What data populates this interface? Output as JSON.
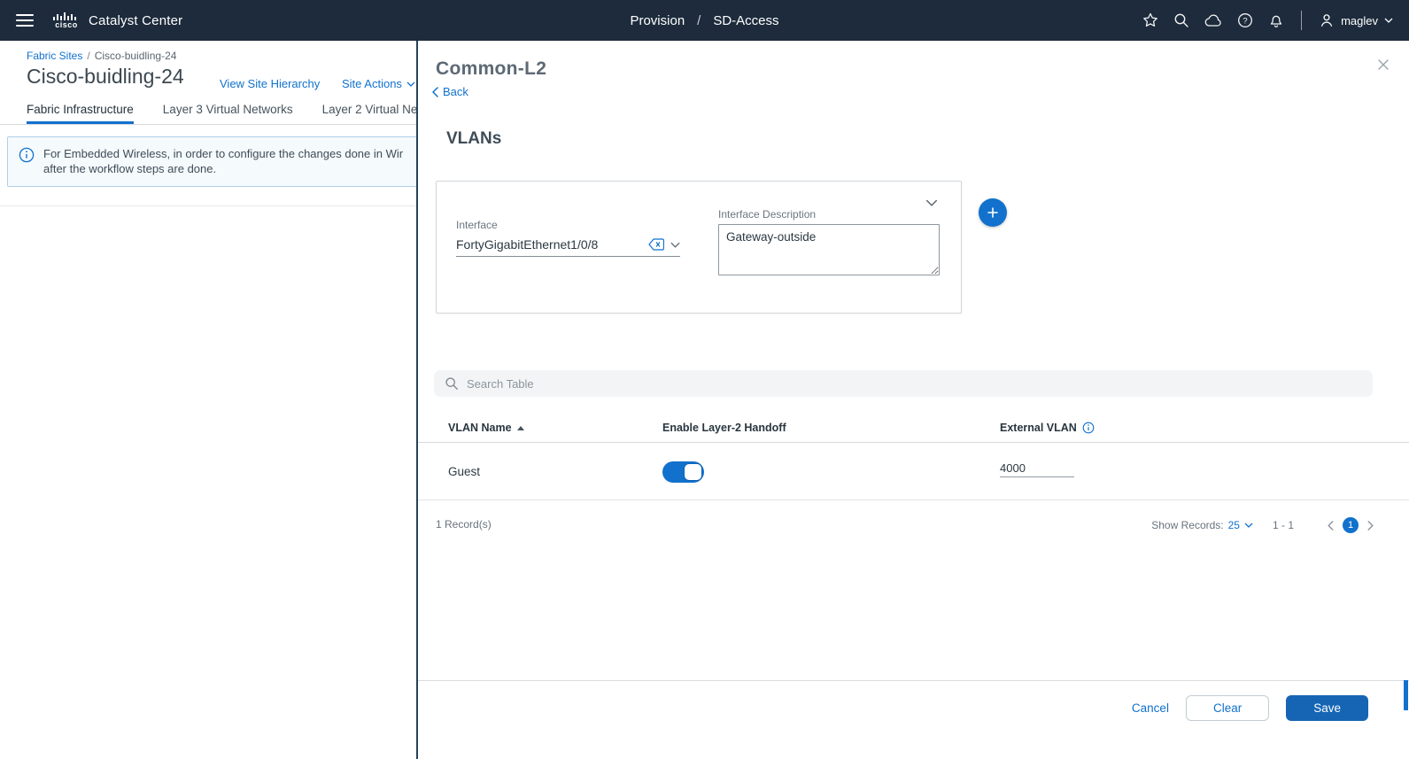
{
  "colors": {
    "topbar_bg": "#1d2b3c",
    "accent": "#1171cd",
    "save_blue": "#1565b4"
  },
  "topbar": {
    "brand": "cisco",
    "app_title": "Catalyst Center",
    "nav": {
      "provision": "Provision",
      "separator": "/",
      "sd_access": "SD-Access"
    },
    "user": "maglev"
  },
  "page": {
    "breadcrumb": {
      "root": "Fabric Sites",
      "separator": "/",
      "current": "Cisco-buidling-24"
    },
    "title": "Cisco-buidling-24",
    "view_site_hierarchy": "View Site Hierarchy",
    "site_actions": "Site Actions",
    "tabs": [
      {
        "label": "Fabric Infrastructure"
      },
      {
        "label": "Layer 3 Virtual Networks"
      },
      {
        "label": "Layer 2 Virtual Ne"
      }
    ],
    "banner": {
      "line1": "For Embedded Wireless, in order to configure the changes done in Wir",
      "line2": "after the workflow steps are done."
    }
  },
  "panel": {
    "title": "Common-L2",
    "back_label": "Back",
    "section_heading": "VLANs",
    "form": {
      "interface_label": "Interface",
      "interface_value": "FortyGigabitEthernet1/0/8",
      "description_label": "Interface Description",
      "description_value": "Gateway-outside"
    },
    "search_placeholder": "Search Table",
    "table": {
      "headers": {
        "vlan_name": "VLAN Name",
        "handoff": "Enable Layer-2 Handoff",
        "external_vlan": "External VLAN"
      },
      "rows": [
        {
          "vlan_name": "Guest",
          "handoff_on": true,
          "external_vlan": "4000"
        }
      ]
    },
    "footer": {
      "records": "1 Record(s)",
      "show_records_label": "Show Records:",
      "show_records_value": "25",
      "range": "1 - 1",
      "page": "1"
    },
    "actions": {
      "cancel": "Cancel",
      "clear": "Clear",
      "save": "Save"
    }
  }
}
